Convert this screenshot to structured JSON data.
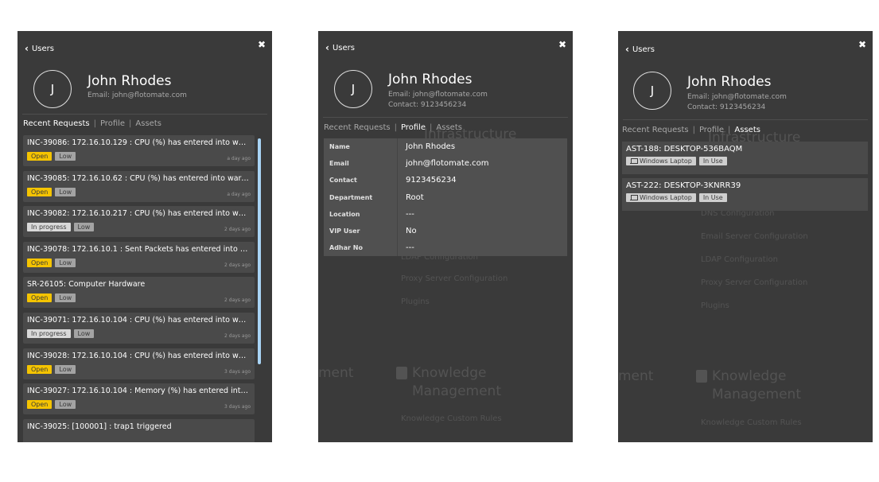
{
  "common": {
    "back_label": "Users",
    "close_glyph": "✖",
    "avatar_letter": "J",
    "user_name": "John Rhodes",
    "email_line": "Email: john@flotomate.com",
    "contact_line": "Contact: 9123456234",
    "tabs": {
      "requests": "Recent Requests",
      "profile": "Profile",
      "assets": "Assets",
      "separator": "|"
    }
  },
  "requests": [
    {
      "title": "INC-39086: 172.16.10.129 : CPU (%) has entered into warnin...",
      "status": "Open",
      "priority": "Low",
      "time": "a day ago"
    },
    {
      "title": "INC-39085: 172.16.10.62 : CPU (%) has entered into warning ...",
      "status": "Open",
      "priority": "Low",
      "time": "a day ago"
    },
    {
      "title": "INC-39082: 172.16.10.217 : CPU (%) has entered into warnin...",
      "status": "In progress",
      "priority": "Low",
      "time": "2 days ago"
    },
    {
      "title": "INC-39078: 172.16.10.1 : Sent Packets has entered into warni...",
      "status": "Open",
      "priority": "Low",
      "time": "2 days ago"
    },
    {
      "title": "SR-26105: Computer Hardware",
      "status": "Open",
      "priority": "Low",
      "time": "2 days ago"
    },
    {
      "title": "INC-39071: 172.16.10.104 : CPU (%) has entered into warnin...",
      "status": "In progress",
      "priority": "Low",
      "time": "2 days ago"
    },
    {
      "title": "INC-39028: 172.16.10.104 : CPU (%) has entered into warnin...",
      "status": "Open",
      "priority": "Low",
      "time": "3 days ago"
    },
    {
      "title": "INC-39027: 172.16.10.104 : Memory (%) has entered into war...",
      "status": "Open",
      "priority": "Low",
      "time": "3 days ago"
    },
    {
      "title": "INC-39025: [100001] : trap1 triggered",
      "status": "",
      "priority": "",
      "time": ""
    }
  ],
  "profile": [
    {
      "key": "Name",
      "value": "John Rhodes"
    },
    {
      "key": "Email",
      "value": "john@flotomate.com"
    },
    {
      "key": "Contact",
      "value": "9123456234"
    },
    {
      "key": "Department",
      "value": "Root"
    },
    {
      "key": "Location",
      "value": "---"
    },
    {
      "key": "VIP User",
      "value": "No"
    },
    {
      "key": "Adhar No",
      "value": "---"
    }
  ],
  "assets": [
    {
      "title": "AST-188: DESKTOP-536BAQM",
      "type": "Windows Laptop",
      "status": "In Use"
    },
    {
      "title": "AST-222: DESKTOP-3KNRR39",
      "type": "Windows Laptop",
      "status": "In Use"
    }
  ],
  "background": {
    "infrastructure": "Infrastructure",
    "dns": "DNS Configuration",
    "email_server": "Email Server Configuration",
    "ldap": "LDAP Configuration",
    "proxy": "Proxy Server Configuration",
    "plugins": "Plugins",
    "ment": "ment",
    "knowledge": "Knowledge",
    "management": "Management",
    "knowledge_rules": "Knowledge Custom Rules"
  },
  "colors": {
    "panel_bg": "#3a3a3a",
    "card_bg": "#4a4a4a",
    "badge_open": "#f5c400",
    "badge_in_progress": "#d9d9d9",
    "badge_low": "#a3a3a3",
    "scrollbar": "#a9d4f5"
  }
}
